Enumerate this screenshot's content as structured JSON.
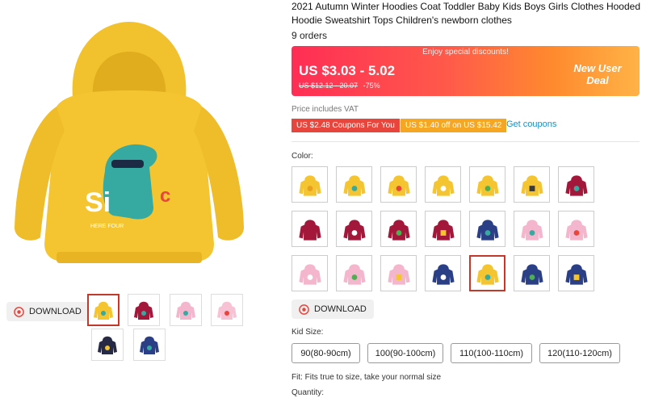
{
  "product": {
    "title": "2021 Autumn Winter Hoodies Coat Toddler Baby Kids Boys Girls Clothes Hooded Hoodie Sweatshirt Tops Children's newborn clothes",
    "orders": "9 orders"
  },
  "price": {
    "banner_top": "Enjoy special discounts!",
    "current": "US $3.03 - 5.02",
    "original": "US $12.12 - 20.07",
    "discount": "-75%",
    "badge": "New User Deal"
  },
  "vat_note": "Price includes VAT",
  "coupons": {
    "coupon1": "US $2.48 Coupons For You",
    "coupon2": "US $1.40 off on US $15.42",
    "get_link": "Get coupons"
  },
  "color": {
    "label": "Color:"
  },
  "download_label": "DOWNLOAD",
  "kid_size": {
    "label": "Kid Size:",
    "options": [
      "90(80-90cm)",
      "100(90-100cm)",
      "110(100-110cm)",
      "120(110-120cm)"
    ]
  },
  "fit_note": "Fit: Fits true to size, take your normal size",
  "quantity_label": "Quantity:",
  "icons": {
    "download": "download-icon",
    "hoodie": "hoodie-icon"
  },
  "colors": {
    "yellow": "#f4c531",
    "burgundy": "#a3173a",
    "pink": "#f4b6cc",
    "navy": "#2b3f86",
    "darknavy": "#262a45",
    "accent_red": "#e8453c",
    "link_blue": "#1b8fc4"
  }
}
